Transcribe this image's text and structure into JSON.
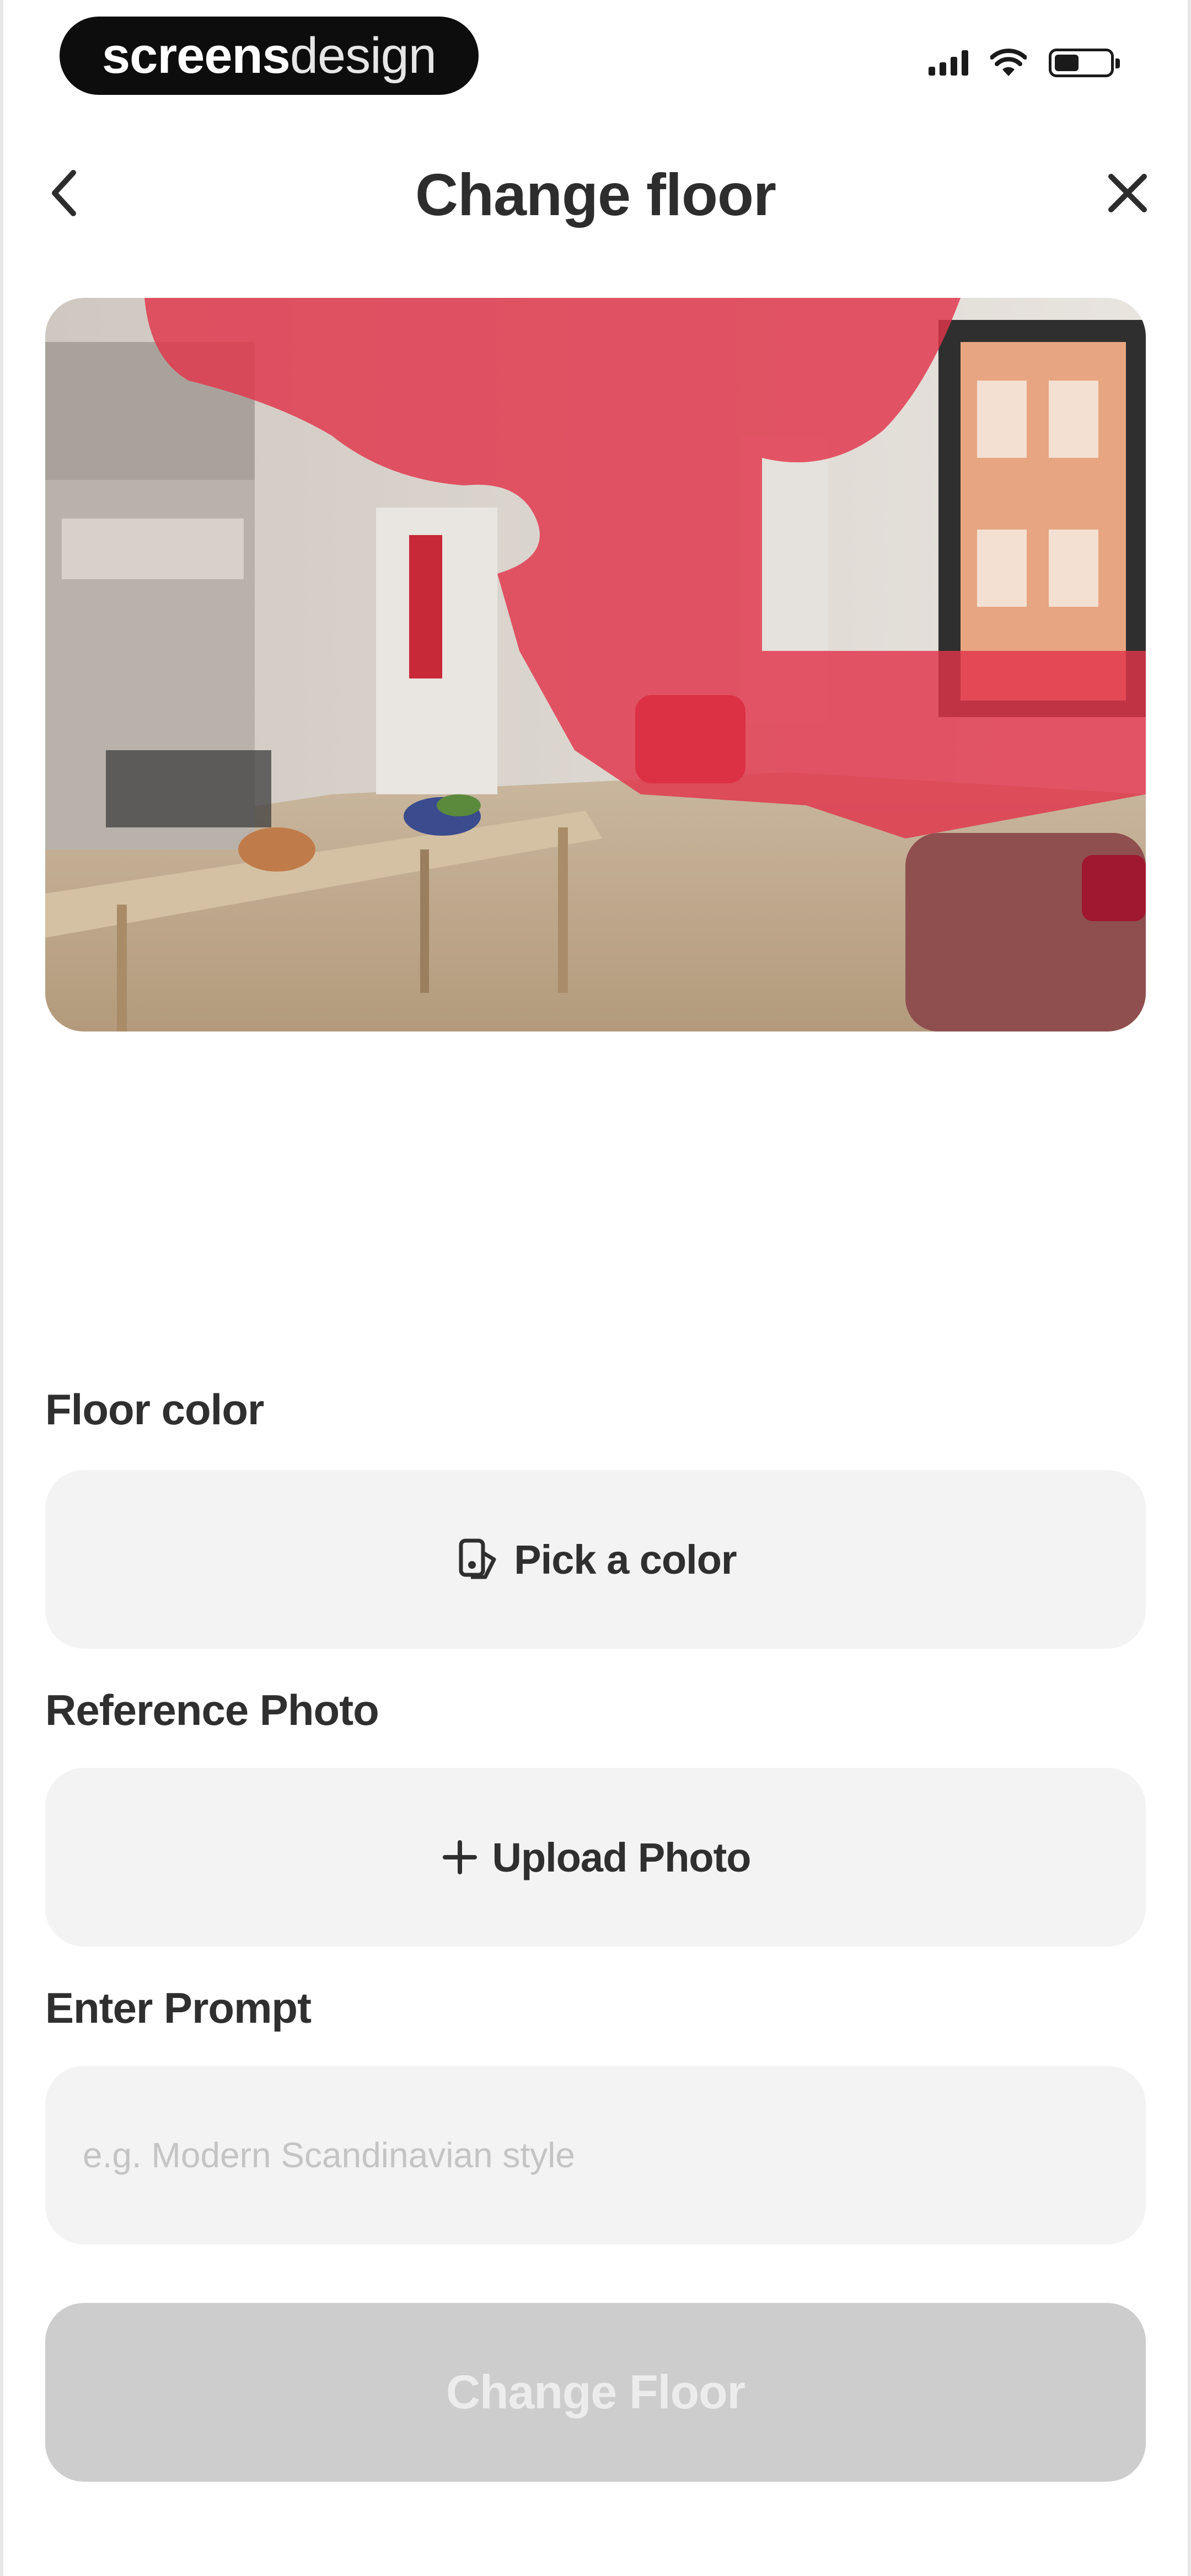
{
  "status_bar": {
    "badge_left": "screens",
    "badge_right": "design",
    "icons": [
      "cellular-signal-icon",
      "wifi-icon",
      "battery-icon"
    ],
    "battery_level": 0.5
  },
  "header": {
    "title": "Change floor",
    "back_icon": "chevron-left-icon",
    "close_icon": "close-icon"
  },
  "photo": {
    "description_icon": "room-photo-with-mask",
    "mask_color": "#e0344a"
  },
  "form": {
    "floor_color_label": "Floor color",
    "pick_color_label": "Pick a color",
    "pick_color_icon": "palette-icon",
    "reference_photo_label": "Reference Photo",
    "upload_photo_label": "Upload Photo",
    "upload_icon": "plus-icon",
    "prompt_label": "Enter Prompt",
    "prompt_placeholder": "e.g. Modern Scandinavian style",
    "prompt_value": ""
  },
  "primary_action": {
    "label": "Change Floor",
    "disabled_color": "#cdcdcd"
  }
}
